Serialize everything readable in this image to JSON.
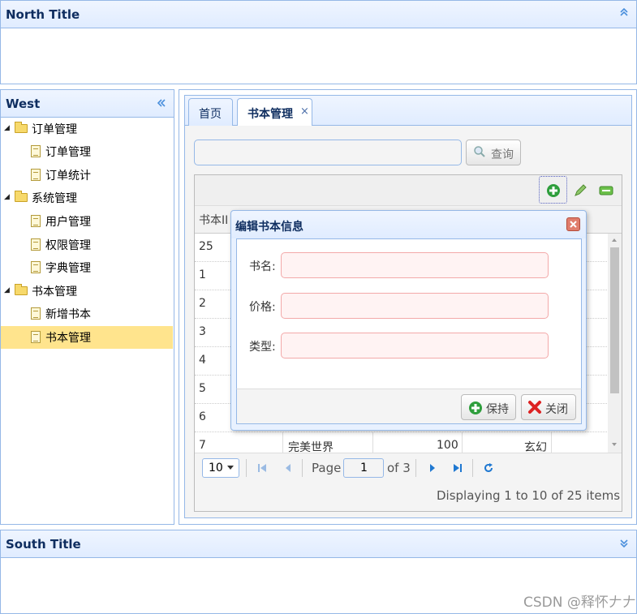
{
  "north": {
    "title": "North Title"
  },
  "west": {
    "title": "West",
    "tree": [
      {
        "label": "订单管理",
        "type": "folder"
      },
      {
        "label": "订单管理",
        "type": "file"
      },
      {
        "label": "订单统计",
        "type": "file"
      },
      {
        "label": "系统管理",
        "type": "folder"
      },
      {
        "label": "用户管理",
        "type": "file"
      },
      {
        "label": "权限管理",
        "type": "file"
      },
      {
        "label": "字典管理",
        "type": "file"
      },
      {
        "label": "书本管理",
        "type": "folder"
      },
      {
        "label": "新增书本",
        "type": "file"
      },
      {
        "label": "书本管理",
        "type": "file",
        "selected": true
      }
    ]
  },
  "south": {
    "title": "South Title"
  },
  "tabs": [
    {
      "label": "首页"
    },
    {
      "label": "书本管理",
      "close": "×"
    }
  ],
  "search": {
    "button": "查询",
    "placeholder": ""
  },
  "grid": {
    "header": "书本II",
    "rows": [
      "25",
      "1",
      "2",
      "3",
      "4",
      "5",
      "6",
      "7"
    ],
    "last_row": {
      "name": "完美世界",
      "price": "100",
      "type": "玄幻"
    }
  },
  "pager": {
    "size": "10",
    "page_label": "Page",
    "page": "1",
    "of": "of 3",
    "display": "Displaying 1 to 10 of 25 items"
  },
  "dialog": {
    "title": "编辑书本信息",
    "fields": [
      {
        "label": "书名:"
      },
      {
        "label": "价格:"
      },
      {
        "label": "类型:"
      }
    ],
    "save": "保持",
    "close": "关闭"
  },
  "watermark": "CSDN @释怀𠂇𠂇"
}
